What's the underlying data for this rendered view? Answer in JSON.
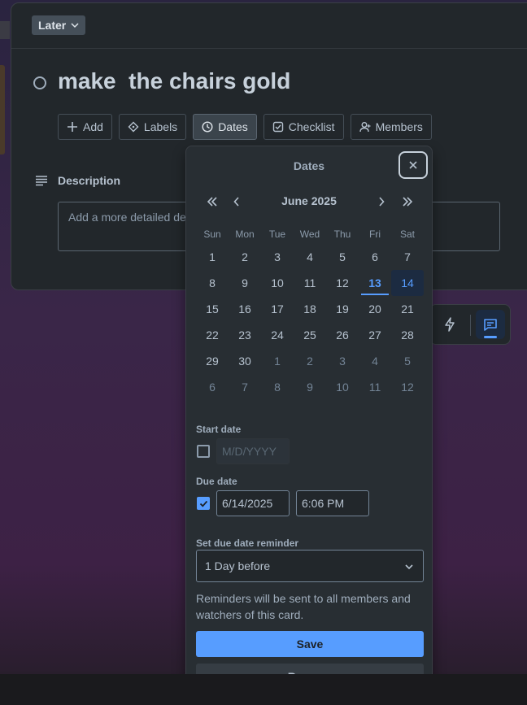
{
  "card": {
    "list_chip": "Later",
    "title": "make  the chairs gold",
    "actions": [
      {
        "label": "Add",
        "icon": "plus-icon"
      },
      {
        "label": "Labels",
        "icon": "tag-icon"
      },
      {
        "label": "Dates",
        "icon": "clock-icon"
      },
      {
        "label": "Checklist",
        "icon": "checkbox-icon"
      },
      {
        "label": "Members",
        "icon": "person-icon"
      }
    ],
    "description_label": "Description",
    "description_placeholder": "Add a more detailed description..."
  },
  "dates_popover": {
    "title": "Dates",
    "month": "June 2025",
    "weekdays": [
      "Sun",
      "Mon",
      "Tue",
      "Wed",
      "Thu",
      "Fri",
      "Sat"
    ],
    "weeks": [
      [
        "1",
        "2",
        "3",
        "4",
        "5",
        "6",
        "7"
      ],
      [
        "8",
        "9",
        "10",
        "11",
        "12",
        "13",
        "14"
      ],
      [
        "15",
        "16",
        "17",
        "18",
        "19",
        "20",
        "21"
      ],
      [
        "22",
        "23",
        "24",
        "25",
        "26",
        "27",
        "28"
      ],
      [
        "29",
        "30",
        "1",
        "2",
        "3",
        "4",
        "5"
      ],
      [
        "6",
        "7",
        "8",
        "9",
        "10",
        "11",
        "12"
      ]
    ],
    "today": "13",
    "selected": "14",
    "start_date": {
      "label": "Start date",
      "placeholder": "M/D/YYYY",
      "checked": false
    },
    "due_date": {
      "label": "Due date",
      "date": "6/14/2025",
      "time": "6:06 PM",
      "checked": true
    },
    "reminder": {
      "label": "Set due date reminder",
      "value": "1 Day before"
    },
    "hint": "Reminders will be sent to all members and watchers of this card.",
    "save_label": "Save",
    "remove_label": "Remove"
  },
  "colors": {
    "accent": "#579dff",
    "panel": "#282e33",
    "modal": "#22272b"
  }
}
